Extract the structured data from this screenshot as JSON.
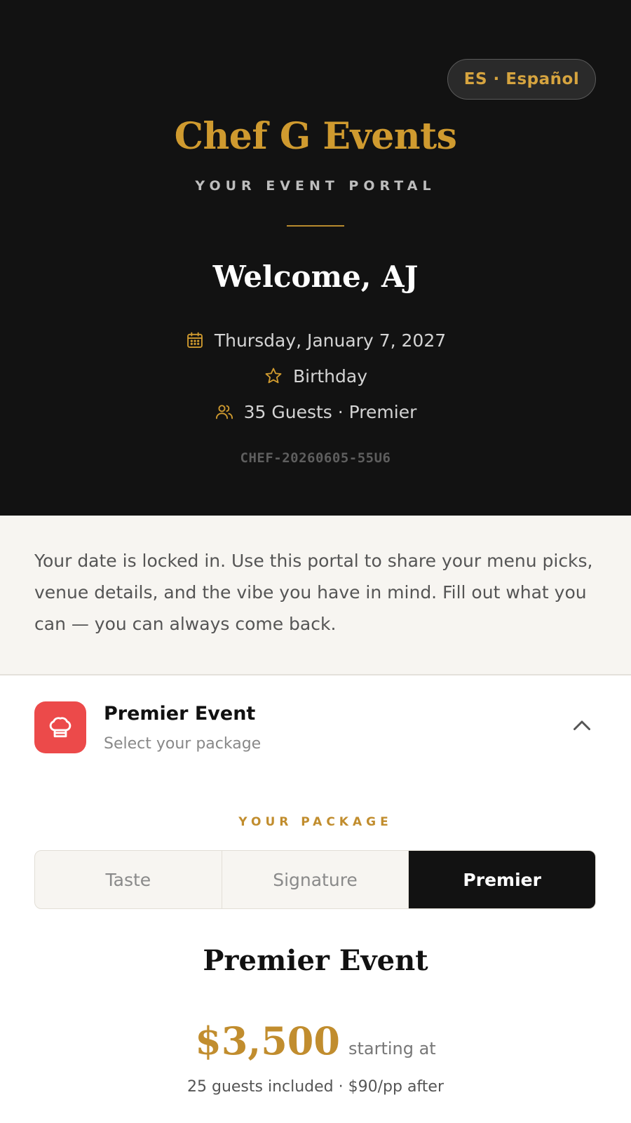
{
  "header": {
    "language_toggle": "ES · Español",
    "brand": "Chef G Events",
    "subtitle": "YOUR EVENT PORTAL",
    "welcome": "Welcome, AJ",
    "event_date": "Thursday, January 7, 2027",
    "event_type": "Birthday",
    "guests_tier": "35 Guests · Premier",
    "event_code": "CHEF-20260605-55U6"
  },
  "intro": {
    "message": "Your date is locked in. Use this portal to share your menu picks, venue details, and the vibe you have in mind. Fill out what you can — you can always come back."
  },
  "package_section": {
    "title": "Premier Event",
    "subtitle": "Select your package",
    "label": "YOUR PACKAGE",
    "tabs": [
      {
        "label": "Taste",
        "selected": false
      },
      {
        "label": "Signature",
        "selected": false
      },
      {
        "label": "Premier",
        "selected": true
      }
    ],
    "plan_name": "Premier Event",
    "price": "$3,500",
    "price_note": "starting at",
    "guests_note": "25 guests included · $90/pp after"
  },
  "colors": {
    "hero_bg": "#121212",
    "gold_accent": "#cf9a2f",
    "badge_red": "#ec4a4a",
    "intro_bg": "#f7f5f1"
  },
  "icons": {
    "date": "calendar-icon",
    "type": "star-icon",
    "guests": "users-icon",
    "package": "chef-hat-icon",
    "collapse": "chevron-up-icon"
  }
}
